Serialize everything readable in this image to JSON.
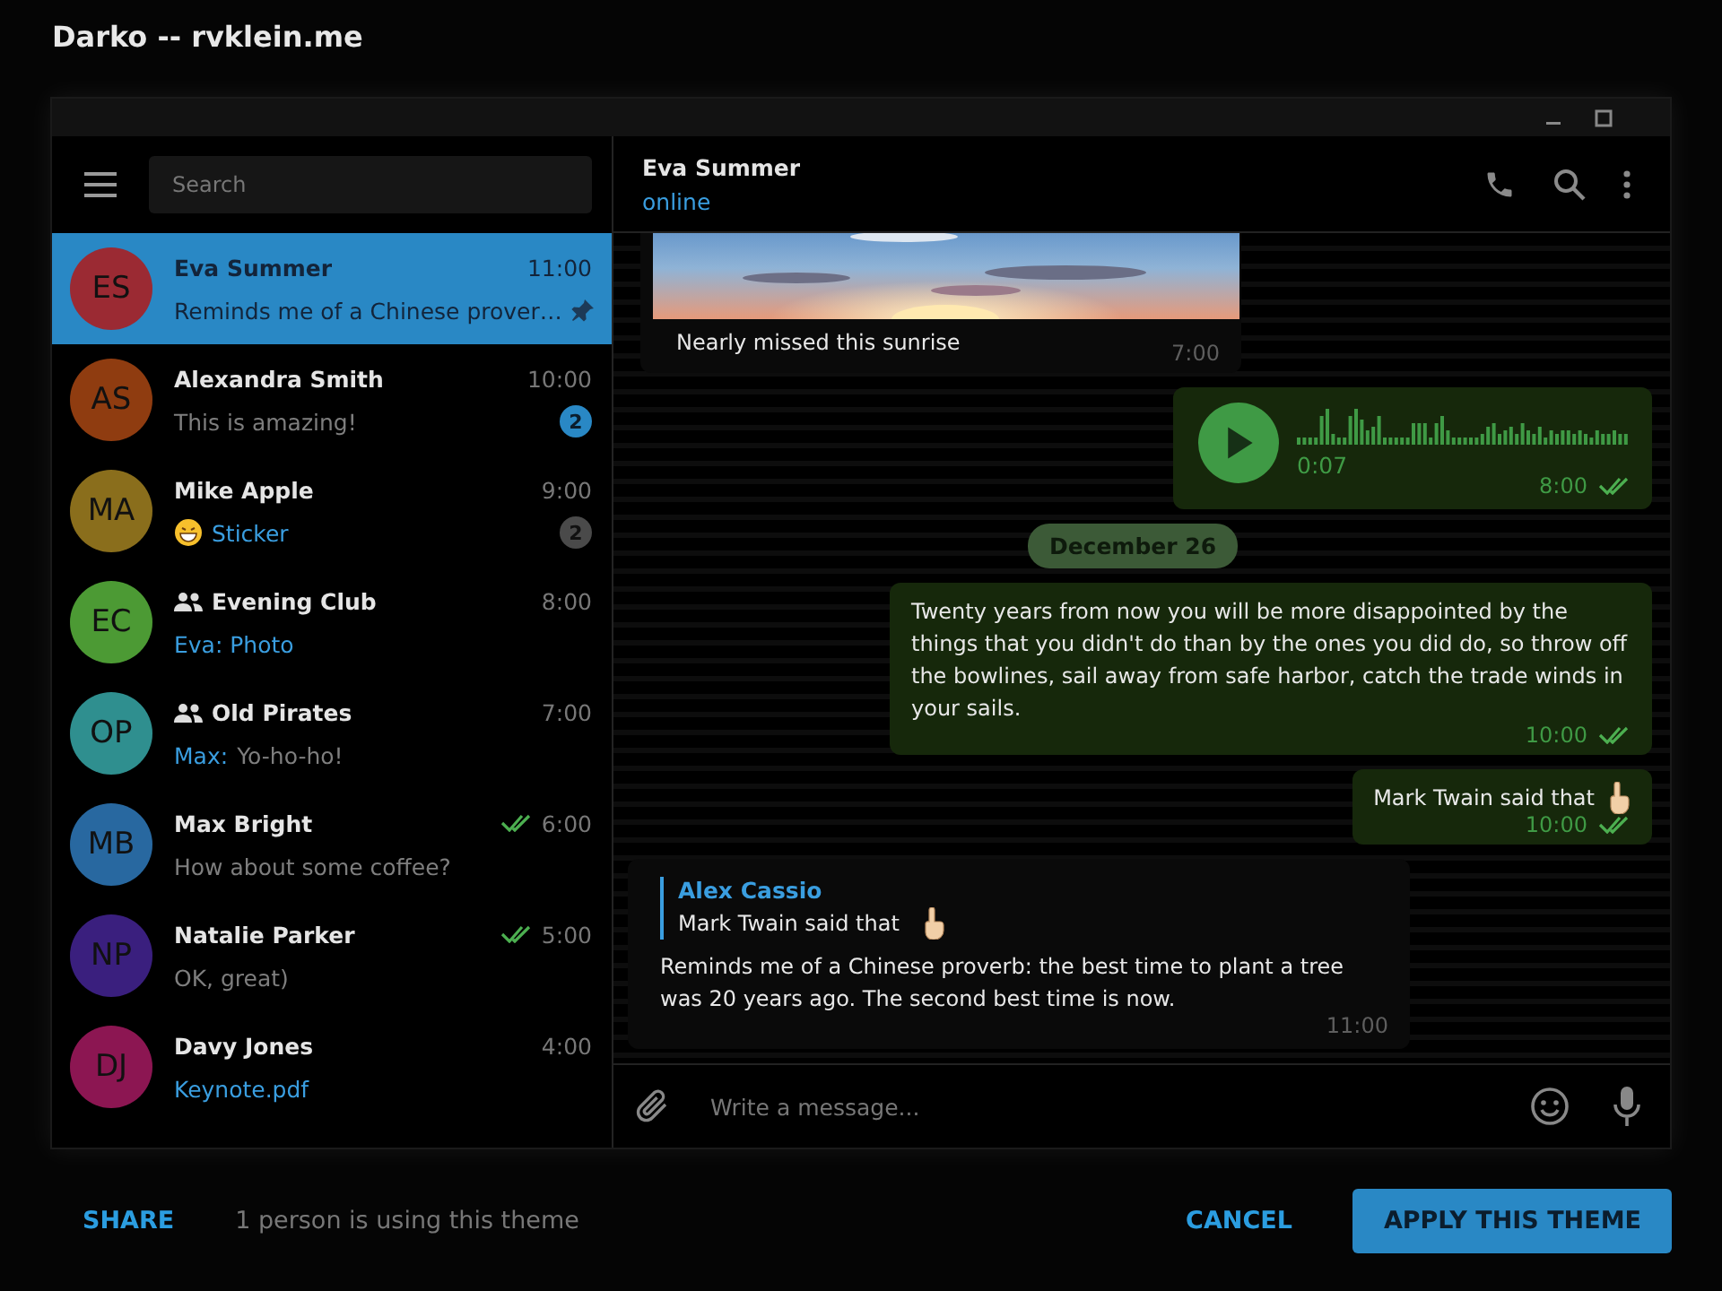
{
  "dialog": {
    "title": "Darko -- rvklein.me"
  },
  "sidebar": {
    "search": {
      "placeholder": "Search"
    },
    "chats": [
      {
        "initials": "ES",
        "color": "#9b2a33",
        "name": "Eva Summer",
        "group": false,
        "time": "11:00",
        "read": false,
        "kind": "text",
        "preview": "Reminds me of a Chinese prover…",
        "pinned": true,
        "selected": true
      },
      {
        "initials": "AS",
        "color": "#8f3c10",
        "name": "Alexandra Smith",
        "group": false,
        "time": "10:00",
        "read": false,
        "kind": "text",
        "preview": "This is amazing!",
        "badge": "2",
        "badge_muted": false,
        "pinned": false,
        "selected": false
      },
      {
        "initials": "MA",
        "color": "#8a6e1c",
        "name": "Mike Apple",
        "group": false,
        "time": "9:00",
        "read": false,
        "kind": "sticker",
        "preview": "Sticker",
        "badge": "2",
        "badge_muted": true,
        "pinned": false,
        "selected": false
      },
      {
        "initials": "EC",
        "color": "#4c9a34",
        "name": "Evening Club",
        "group": true,
        "time": "8:00",
        "read": false,
        "kind": "media",
        "preview": "Eva: Photo",
        "pinned": false,
        "selected": false
      },
      {
        "initials": "OP",
        "color": "#2f8f8f",
        "name": "Old Pirates",
        "group": true,
        "time": "7:00",
        "read": false,
        "kind": "text",
        "sender": "Max:",
        "preview": "Yo-ho-ho!",
        "pinned": false,
        "selected": false
      },
      {
        "initials": "MB",
        "color": "#2868a0",
        "name": "Max Bright",
        "group": false,
        "time": "6:00",
        "read": true,
        "kind": "text",
        "preview": "How about some coffee?",
        "pinned": false,
        "selected": false
      },
      {
        "initials": "NP",
        "color": "#3a1f7e",
        "name": "Natalie Parker",
        "group": false,
        "time": "5:00",
        "read": true,
        "kind": "text",
        "preview": "OK, great)",
        "pinned": false,
        "selected": false
      },
      {
        "initials": "DJ",
        "color": "#8c1652",
        "name": "Davy Jones",
        "group": false,
        "time": "4:00",
        "read": false,
        "kind": "media",
        "preview": "Keynote.pdf",
        "pinned": false,
        "selected": false
      }
    ]
  },
  "chat": {
    "name": "Eva Summer",
    "status": "online",
    "messages": [
      {
        "outgoing": false,
        "caption": "Nearly missed this sunrise",
        "time": "7:00",
        "read": false
      },
      {
        "kind": "voice",
        "outgoing": true,
        "duration": "0:07",
        "time": "8:00",
        "read": true
      },
      {
        "kind": "date",
        "label": "December 26"
      },
      {
        "kind": "text",
        "outgoing": true,
        "text": "Twenty years from now you will be more disappointed by the things that you didn't do than by the ones you did do, so throw off the bowlines, sail away from safe harbor, catch the trade winds in your sails.",
        "hand": false,
        "time": "10:00",
        "read": true
      },
      {
        "kind": "text",
        "outgoing": true,
        "text": "Mark Twain said that",
        "hand": true,
        "time": "10:00",
        "read": true
      },
      {
        "kind": "reply",
        "outgoing": false,
        "reply_author": "Alex Cassio",
        "reply_text": "Mark Twain said that",
        "reply_hand": true,
        "text": "Reminds me of a Chinese proverb: the best time to plant a tree was 20 years ago. The second best time is now.",
        "time": "11:00",
        "read": false
      }
    ],
    "composer": {
      "placeholder": "Write a message..."
    }
  },
  "footer": {
    "share": "SHARE",
    "usage": "1 person is using this theme",
    "cancel": "CANCEL",
    "apply": "APPLY THIS THEME"
  }
}
